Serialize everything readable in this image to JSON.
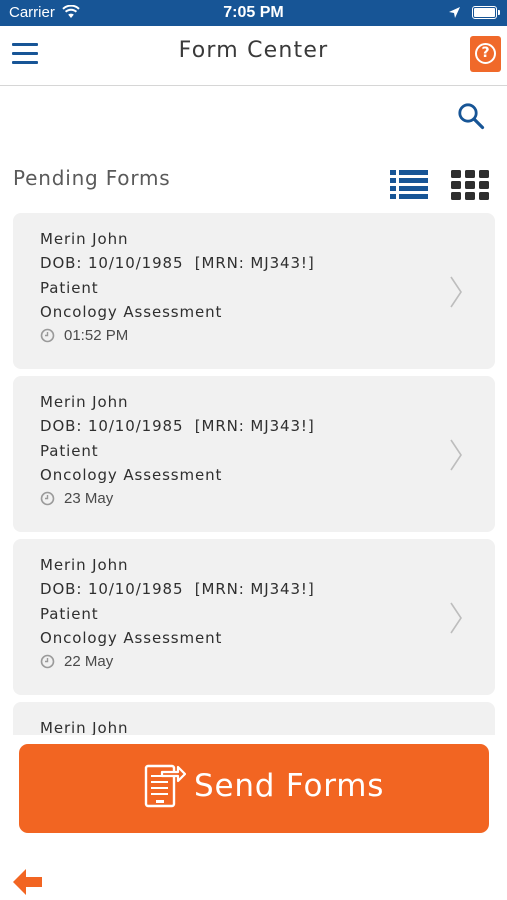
{
  "status_bar": {
    "carrier": "Carrier",
    "time": "7:05 PM"
  },
  "nav": {
    "title": "Form Center",
    "help_label": "?"
  },
  "section": {
    "title": "Pending Forms"
  },
  "forms": [
    {
      "name": "Merin John",
      "dob_line": "DOB: 10/10/1985  [MRN: MJ343!]",
      "role": "Patient",
      "form_name": "Oncology Assessment",
      "time": "01:52 PM"
    },
    {
      "name": "Merin John",
      "dob_line": "DOB: 10/10/1985  [MRN: MJ343!]",
      "role": "Patient",
      "form_name": "Oncology Assessment",
      "time": "23 May"
    },
    {
      "name": "Merin John",
      "dob_line": "DOB: 10/10/1985  [MRN: MJ343!]",
      "role": "Patient",
      "form_name": "Oncology Assessment",
      "time": "22 May"
    },
    {
      "name": "Merin John"
    }
  ],
  "send_button": {
    "label": "Send Forms"
  },
  "colors": {
    "brand_blue": "#175596",
    "accent_orange": "#f26522",
    "card_background": "#f1f1f1"
  },
  "icons": {
    "menu": "hamburger-icon",
    "help": "question-icon",
    "search": "search-icon",
    "list_view": "list-view-icon",
    "grid_view": "grid-view-icon",
    "clock": "clock-icon",
    "chevron": "chevron-right-icon",
    "send": "send-forms-icon",
    "back": "back-arrow-icon"
  }
}
